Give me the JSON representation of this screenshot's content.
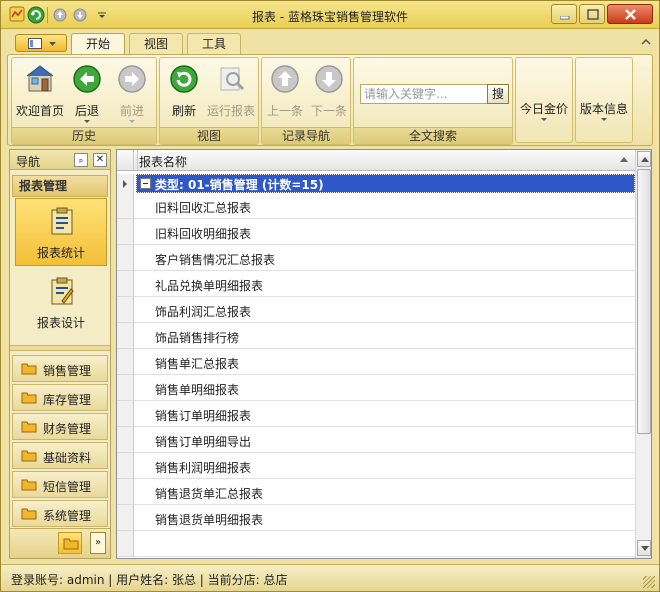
{
  "window": {
    "title": "报表 - 蓝格珠宝销售管理软件"
  },
  "tabs": [
    {
      "label": "开始"
    },
    {
      "label": "视图"
    },
    {
      "label": "工具"
    }
  ],
  "ribbon": {
    "history": {
      "label": "历史",
      "home": "欢迎首页",
      "back": "后退",
      "forward": "前进"
    },
    "view": {
      "label": "视图",
      "refresh": "刷新",
      "run_report": "运行报表"
    },
    "record_nav": {
      "label": "记录导航",
      "prev": "上一条",
      "next": "下一条"
    },
    "fulltext": {
      "label": "全文搜索",
      "placeholder": "请输入关键字...",
      "search_button": "搜"
    },
    "gold_price": "今日金价",
    "version_info": "版本信息"
  },
  "nav": {
    "title": "导航",
    "pin_glyph": "ₚ",
    "close_glyph": "✕",
    "section": "报表管理",
    "items": [
      {
        "label": "报表统计"
      },
      {
        "label": "报表设计"
      }
    ],
    "groups": [
      {
        "label": "销售管理"
      },
      {
        "label": "库存管理"
      },
      {
        "label": "财务管理"
      },
      {
        "label": "基础资料"
      },
      {
        "label": "短信管理"
      },
      {
        "label": "系统管理"
      }
    ],
    "more_glyph": "»"
  },
  "grid": {
    "column": "报表名称",
    "group_label": "类型: 01-销售管理 (计数=15)",
    "rows": [
      "旧料回收汇总报表",
      "旧料回收明细报表",
      "客户销售情况汇总报表",
      "礼品兑换单明细报表",
      "饰品利润汇总报表",
      "饰品销售排行榜",
      "销售单汇总报表",
      "销售单明细报表",
      "销售订单明细报表",
      "销售订单明细导出",
      "销售利润明细报表",
      "销售退货单汇总报表",
      "销售退货单明细报表"
    ]
  },
  "status": {
    "text": "登录账号: admin  |  用户姓名: 张总  |  当前分店: 总店"
  },
  "colors": {
    "group_band": "#2e58c8",
    "theme_gold": "#f0c040",
    "frame": "#efe2a4"
  }
}
